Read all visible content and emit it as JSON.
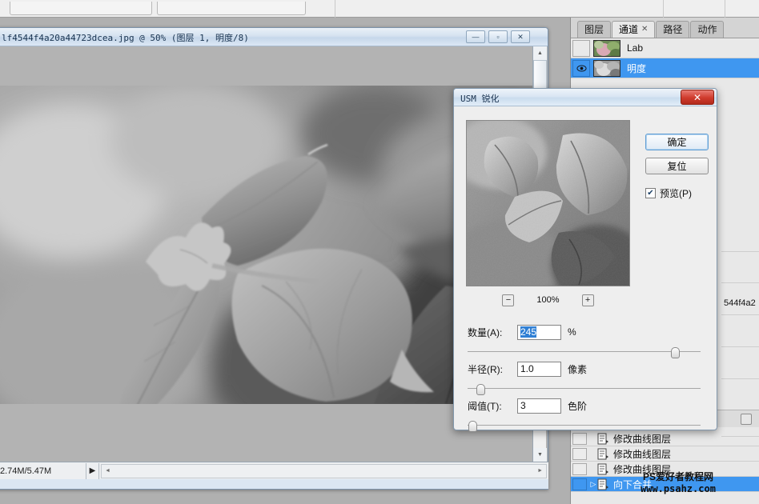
{
  "document": {
    "title": "lf4544f4a20a44723dcea.jpg @ 50%  (图层 1, 明度/8)",
    "minimize_label": "—",
    "restore_label": "▫",
    "close_label": "✕",
    "status_size": "2.74M/5.47M",
    "status_play_icon": "▶",
    "scroll_left_icon": "◄",
    "scroll_right_icon": "►",
    "scroll_up_icon": "▲",
    "scroll_down_icon": "▼"
  },
  "panel": {
    "tabs": [
      {
        "label": "图层",
        "active": false,
        "closable": false
      },
      {
        "label": "通道",
        "active": true,
        "closable": true,
        "close_glyph": "✕"
      },
      {
        "label": "路径",
        "active": false,
        "closable": false
      },
      {
        "label": "动作",
        "active": false,
        "closable": false
      }
    ],
    "channels": [
      {
        "name": "Lab",
        "visible": false,
        "selected": false
      },
      {
        "name": "明度",
        "visible": true,
        "selected": true
      }
    ],
    "history": [
      {
        "label": "修改曲线图层",
        "selected": false,
        "has_arrow": false
      },
      {
        "label": "修改曲线图层",
        "selected": false,
        "has_arrow": false
      },
      {
        "label": "修改曲线图层",
        "selected": false,
        "has_arrow": false
      },
      {
        "label": "向下合并",
        "selected": true,
        "has_arrow": true,
        "arrow_glyph": "▷"
      }
    ],
    "right_edge_fragment": "544f4a2"
  },
  "usm_dialog": {
    "title": "USM 锐化",
    "close_label": "✕",
    "ok_label": "确定",
    "reset_label": "复位",
    "preview_label": "预览(P)",
    "preview_checked": true,
    "check_glyph": "✔",
    "zoom_out_label": "−",
    "zoom_in_label": "+",
    "zoom_level": "100%",
    "fields": [
      {
        "label": "数量(A):",
        "value": "245",
        "unit": "%",
        "selected_text": true,
        "slider_pct": 88
      },
      {
        "label": "半径(R):",
        "value": "1.0",
        "unit": "像素",
        "selected_text": false,
        "slider_pct": 5
      },
      {
        "label": "阈值(T):",
        "value": "3",
        "unit": "色阶",
        "selected_text": false,
        "slider_pct": 1
      }
    ]
  },
  "watermark": {
    "line1": "PS爱好者教程网",
    "line2": "www.psahz.com"
  },
  "colors": {
    "selection_blue": "#3f97f0",
    "title_blue": "#17324f",
    "close_red": "#cf3a2c",
    "workspace_gray": "#b0b0b0"
  }
}
